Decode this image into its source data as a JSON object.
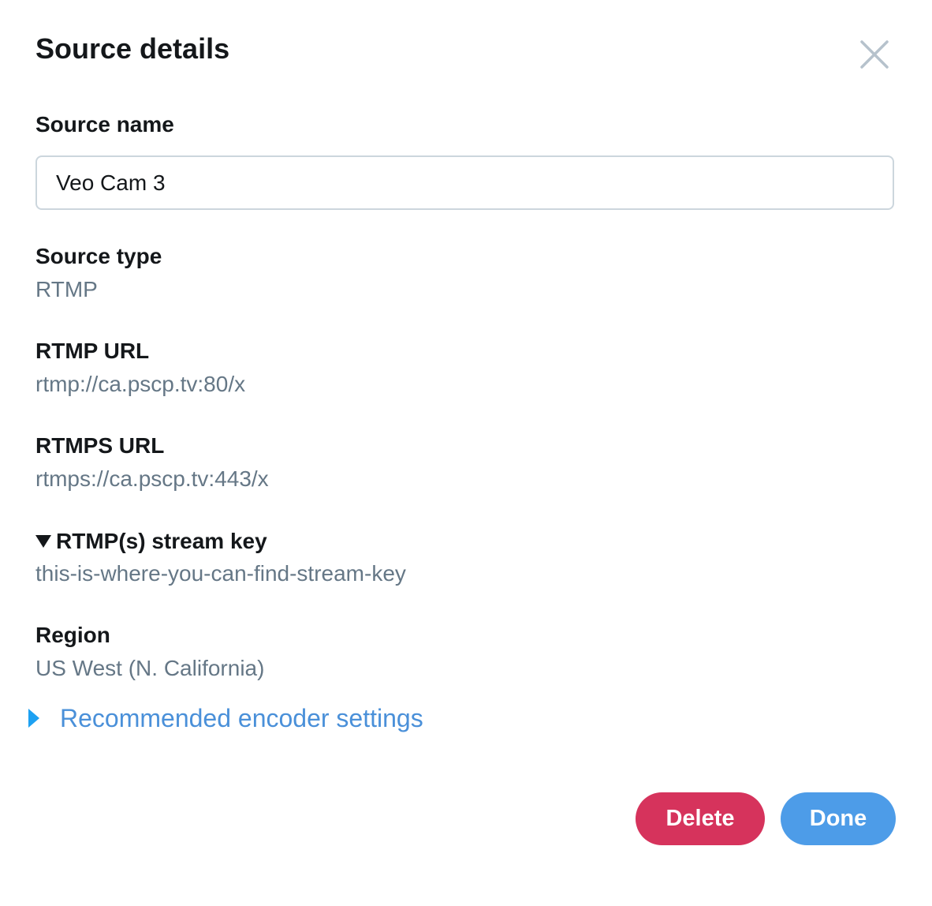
{
  "dialog": {
    "title": "Source details"
  },
  "source_name": {
    "label": "Source name",
    "value": "Veo Cam 3"
  },
  "source_type": {
    "label": "Source type",
    "value": "RTMP"
  },
  "rtmp_url": {
    "label": "RTMP URL",
    "value": "rtmp://ca.pscp.tv:80/x"
  },
  "rtmps_url": {
    "label": "RTMPS URL",
    "value": "rtmps://ca.pscp.tv:443/x"
  },
  "stream_key": {
    "label": "RTMP(s) stream key",
    "value": "this-is-where-you-can-find-stream-key",
    "expanded": true
  },
  "region": {
    "label": "Region",
    "value": "US West (N. California)"
  },
  "encoder_settings": {
    "label": "Recommended encoder settings",
    "expanded": false
  },
  "actions": {
    "delete_label": "Delete",
    "done_label": "Done"
  },
  "icons": {
    "close": "close-icon",
    "expanded": "caret-down-icon",
    "collapsed": "caret-right-icon"
  },
  "colors": {
    "delete": "#d6335c",
    "done": "#4d9ce8",
    "link": "#4a90d9",
    "muted_text": "#657786",
    "close_icon": "#b6c2cc"
  }
}
